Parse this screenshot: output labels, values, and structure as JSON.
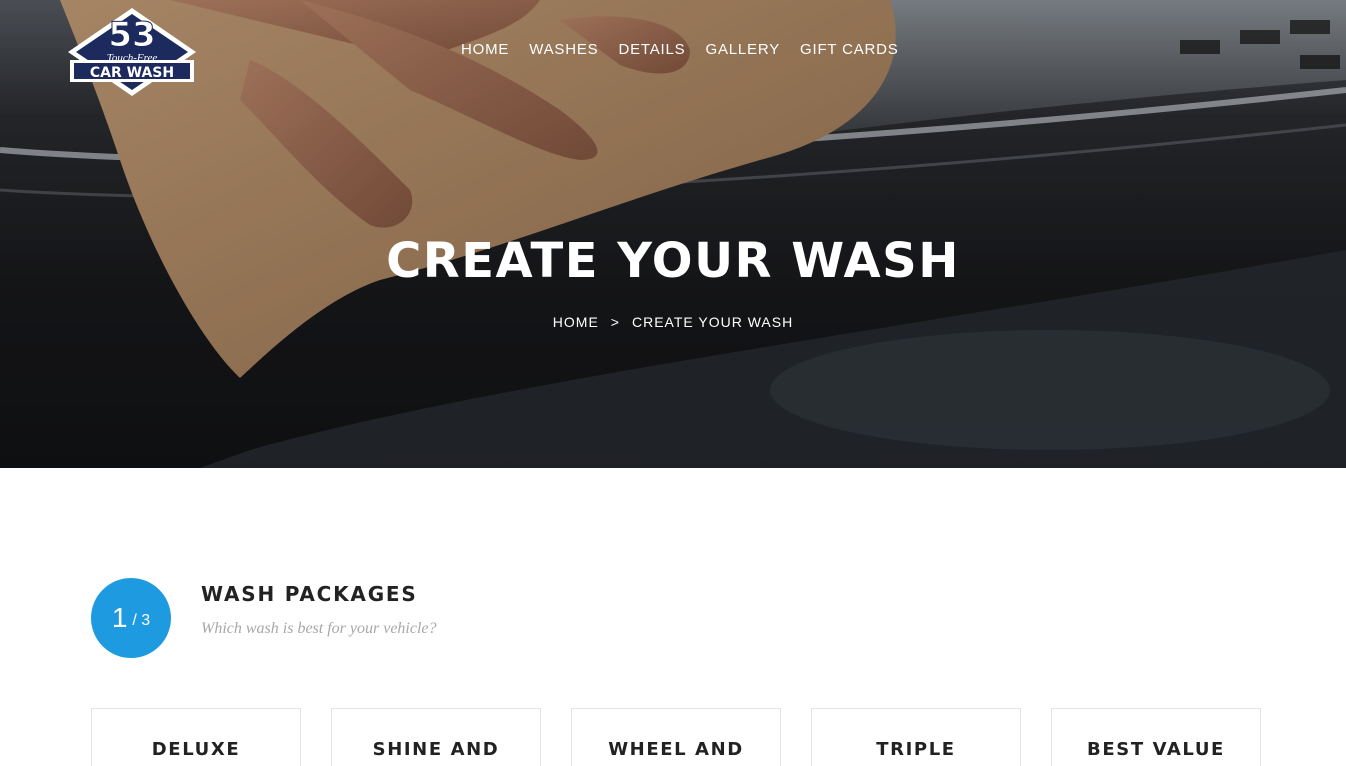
{
  "brand": {
    "number": "53",
    "tagline": "Touch-Free",
    "name": "CAR WASH"
  },
  "nav": {
    "items": [
      "HOME",
      "WASHES",
      "DETAILS",
      "GALLERY",
      "GIFT CARDS"
    ]
  },
  "hero": {
    "title": "CREATE YOUR WASH",
    "breadcrumb": {
      "home": "HOME",
      "separator": ">",
      "current": "CREATE YOUR WASH"
    }
  },
  "step": {
    "current": "1",
    "total": "/ 3",
    "title": "WASH PACKAGES",
    "subtitle": "Which wash is best for your vehicle?"
  },
  "packages": [
    "DELUXE",
    "SHINE AND",
    "WHEEL AND",
    "TRIPLE",
    "BEST VALUE"
  ],
  "colors": {
    "accent": "#1e9be0",
    "logo_navy": "#1c2a5e"
  },
  "icons": {
    "breadcrumb_separator": "chevron-right-icon"
  }
}
